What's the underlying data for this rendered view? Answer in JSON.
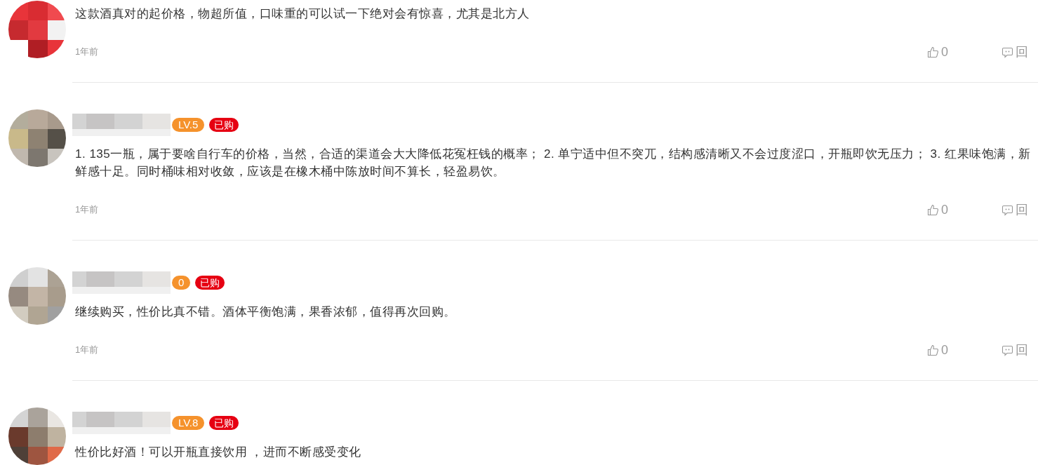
{
  "comments": [
    {
      "text": "这款酒真对的起价格，物超所值，口味重的可以试一下绝对会有惊喜，尤其是北方人",
      "time": "1年前",
      "likes": "0",
      "reply": "回"
    },
    {
      "header": {
        "level_badge": "LV.5",
        "bought_badge": "已购"
      },
      "text": "1. 135一瓶，属于要啥自行车的价格，当然，合适的渠道会大大降低花冤枉钱的概率；  2. 单宁适中但不突兀，结构感清晰又不会过度涩口，开瓶即饮无压力；  3. 红果味饱满，新鲜感十足。同时桶味相对收敛，应该是在橡木桶中陈放时间不算长，轻盈易饮。",
      "time": "1年前",
      "likes": "0",
      "reply": "回"
    },
    {
      "header": {
        "level_badge": "0",
        "bought_badge": "已购"
      },
      "text": "继续购买，性价比真不错。酒体平衡饱满，果香浓郁，值得再次回购。",
      "time": "1年前",
      "likes": "0",
      "reply": "回"
    },
    {
      "header": {
        "level_badge": "LV.8",
        "bought_badge": "已购"
      },
      "text": "性价比好酒！可以开瓶直接饮用 ，进而不断感受变化"
    }
  ]
}
